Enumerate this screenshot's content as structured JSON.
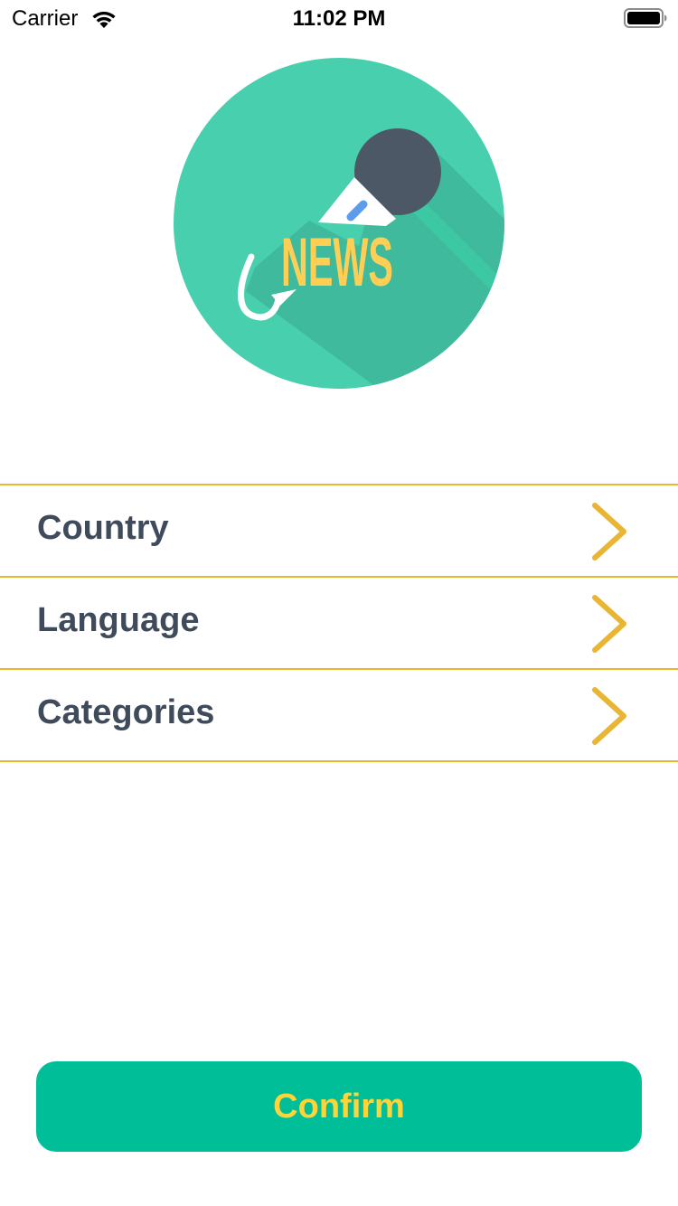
{
  "status_bar": {
    "carrier": "Carrier",
    "time": "11:02 PM",
    "wifi_icon": "wifi-icon",
    "battery_icon": "battery-icon"
  },
  "logo": {
    "text": "NEWS",
    "icon": "microphone-icon",
    "colors": {
      "circle": "#48cfad",
      "shadow": "#40ba9c",
      "mic_head": "#4d5866",
      "text": "#ffce54",
      "accent": "#5d9cec"
    }
  },
  "settings": {
    "items": [
      {
        "label": "Country",
        "icon": "chevron-right-icon"
      },
      {
        "label": "Language",
        "icon": "chevron-right-icon"
      },
      {
        "label": "Categories",
        "icon": "chevron-right-icon"
      }
    ]
  },
  "confirm": {
    "label": "Confirm"
  },
  "colors": {
    "divider": "#e8b634",
    "chevron": "#e8b634",
    "label": "#3f4a5a",
    "button_bg": "#00bf98",
    "button_text": "#ffd43b"
  }
}
